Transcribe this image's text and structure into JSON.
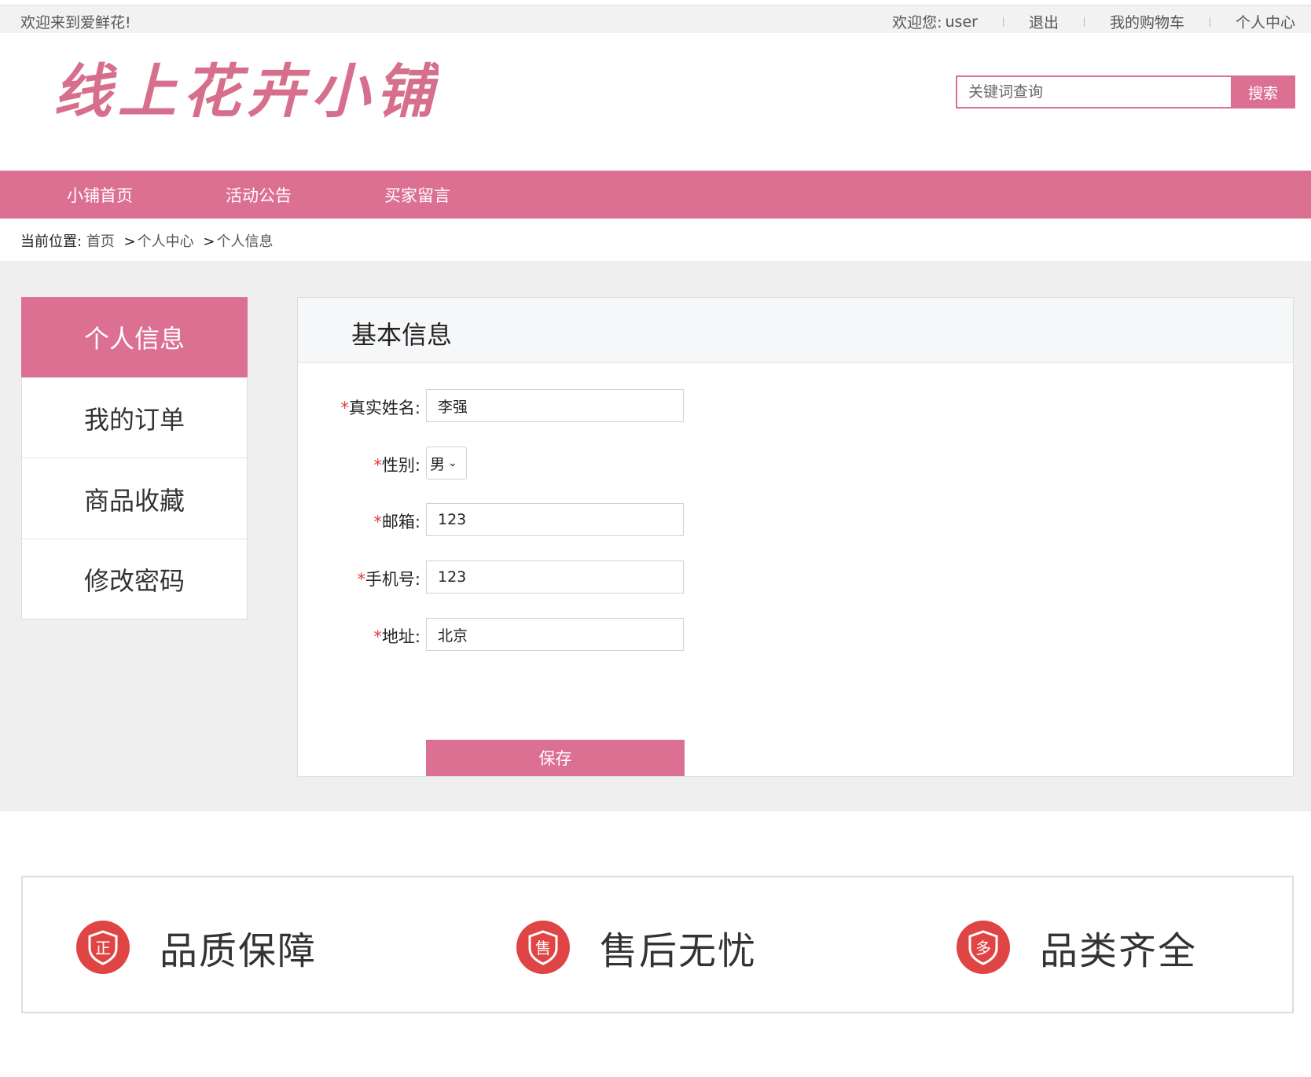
{
  "topbar": {
    "welcome": "欢迎来到爱鲜花!",
    "user_label": "欢迎您:",
    "username": "user",
    "logout": "退出",
    "cart": "我的购物车",
    "profile": "个人中心"
  },
  "header": {
    "logo_text": "线上花卉小铺",
    "search_placeholder": "关键词查询",
    "search_button": "搜索"
  },
  "nav": {
    "items": [
      "小铺首页",
      "活动公告",
      "买家留言"
    ]
  },
  "breadcrumb": {
    "label": "当前位置:",
    "items": [
      "首页",
      "个人中心",
      "个人信息"
    ],
    "separator": ">"
  },
  "sidebar": {
    "items": [
      "个人信息",
      "我的订单",
      "商品收藏",
      "修改密码"
    ],
    "active_index": 0
  },
  "panel": {
    "title": "基本信息",
    "fields": {
      "name": {
        "label": "真实姓名:",
        "value": "李强"
      },
      "gender": {
        "label": "性别:",
        "value": "男"
      },
      "email": {
        "label": "邮箱:",
        "value": "123"
      },
      "phone": {
        "label": "手机号:",
        "value": "123"
      },
      "address": {
        "label": "地址:",
        "value": "北京"
      }
    },
    "required_mark": "*",
    "save_button": "保存"
  },
  "features": [
    {
      "icon": "正",
      "icon_name": "quality-shield-icon",
      "text": "品质保障"
    },
    {
      "icon": "售",
      "icon_name": "after-sales-shield-icon",
      "text": "售后无忧"
    },
    {
      "icon": "多",
      "icon_name": "variety-shield-icon",
      "text": "品类齐全"
    }
  ],
  "colors": {
    "accent": "#dc7093",
    "badge": "#e04545",
    "required": "#e23c3c"
  }
}
